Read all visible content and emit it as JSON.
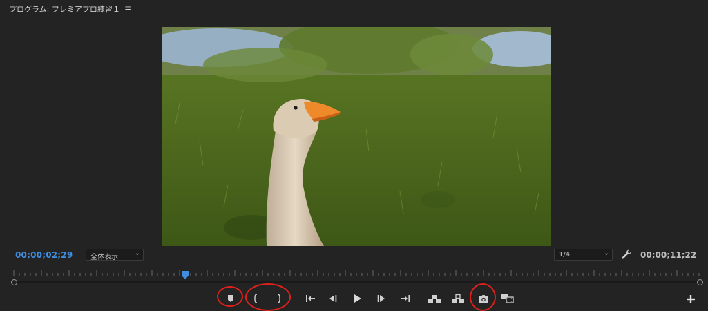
{
  "panel": {
    "title": "プログラム: プレミアプロ練習１",
    "menu_icon": "hamburger-menu-icon"
  },
  "monitor": {
    "current_timecode": "00;00;02;29",
    "zoom_value": "全体表示",
    "resolution_value": "1/4",
    "duration_timecode": "00;00;11;22",
    "timecode_color": "#3f8ee0",
    "playhead_color": "#3f8ee0",
    "playhead_position": 0.25
  },
  "controls": [
    {
      "name": "add-marker-button",
      "icon": "marker-icon"
    },
    {
      "name": "mark-in-button",
      "icon": "mark-in-icon"
    },
    {
      "name": "mark-out-button",
      "icon": "mark-out-icon"
    },
    {
      "name": "go-to-in-button",
      "icon": "go-to-in-icon"
    },
    {
      "name": "step-back-button",
      "icon": "step-back-icon"
    },
    {
      "name": "play-button",
      "icon": "play-icon"
    },
    {
      "name": "step-forward-button",
      "icon": "step-forward-icon"
    },
    {
      "name": "go-to-out-button",
      "icon": "go-to-out-icon"
    },
    {
      "name": "lift-button",
      "icon": "lift-icon"
    },
    {
      "name": "extract-button",
      "icon": "extract-icon"
    },
    {
      "name": "export-frame-button",
      "icon": "camera-icon"
    },
    {
      "name": "comparison-view-button",
      "icon": "comparison-view-icon"
    },
    {
      "name": "button-editor-button",
      "icon": "plus-icon"
    }
  ],
  "annotation_color": "#e0201a"
}
